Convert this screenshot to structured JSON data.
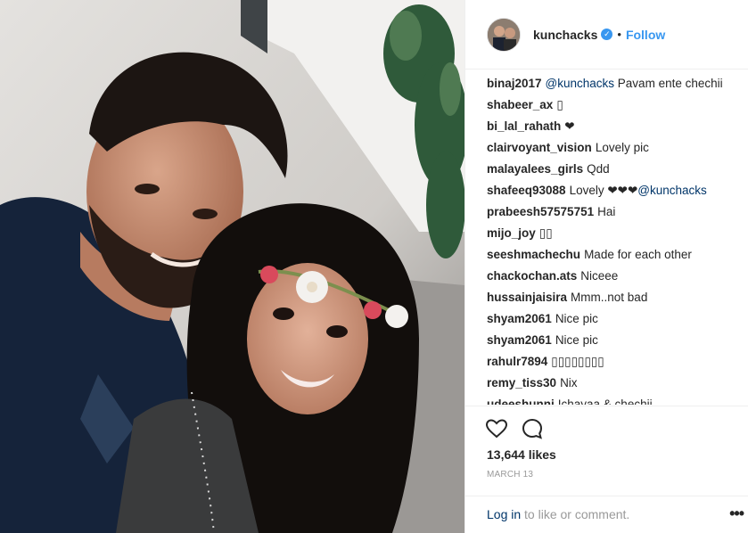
{
  "post": {
    "username": "kunchacks",
    "follow_label": "Follow",
    "dot": "•",
    "verified_glyph": "✓"
  },
  "comments": [
    {
      "user": "binaj2017",
      "mention": "@kunchacks",
      "text": " Pavam ente chechii"
    },
    {
      "user": "shabeer_ax",
      "mention": "",
      "text": "▯"
    },
    {
      "user": "bi_lal_rahath",
      "mention": "",
      "text": "❤"
    },
    {
      "user": "clairvoyant_vision",
      "mention": "",
      "text": "Lovely pic"
    },
    {
      "user": "malayalees_girls",
      "mention": "",
      "text": "Qdd"
    },
    {
      "user": "shafeeq93088",
      "mention": "",
      "text": "Lovely ❤❤❤",
      "mention_after": "@kunchacks"
    },
    {
      "user": "prabeesh57575751",
      "mention": "",
      "text": "Hai"
    },
    {
      "user": "mijo_joy",
      "mention": "",
      "text": "▯▯"
    },
    {
      "user": "seeshmachechu",
      "mention": "",
      "text": "Made for each other"
    },
    {
      "user": "chackochan.ats",
      "mention": "",
      "text": "Niceee"
    },
    {
      "user": "hussainjaisira",
      "mention": "",
      "text": "Mmm..not bad"
    },
    {
      "user": "shyam2061",
      "mention": "",
      "text": "Nice pic"
    },
    {
      "user": "shyam2061",
      "mention": "",
      "text": "Nice pic"
    },
    {
      "user": "rahulr7894",
      "mention": "",
      "text": "▯▯▯▯▯▯▯▯"
    },
    {
      "user": "remy_tiss30",
      "mention": "",
      "text": "Nix"
    },
    {
      "user": "udeeshunni",
      "mention": "",
      "text": "Ichayaa & chechii"
    }
  ],
  "actions": {
    "like_icon": "heart-outline",
    "comment_icon": "speech-bubble",
    "likes": "13,644 likes",
    "date": "MARCH 13"
  },
  "login": {
    "link": "Log in",
    "rest": " to like or comment.",
    "more": "•••"
  },
  "colors": {
    "link_blue": "#3897f0",
    "mention": "#003569",
    "muted": "#999999"
  }
}
